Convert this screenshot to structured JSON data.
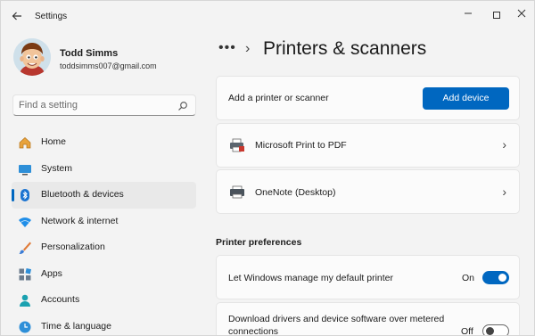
{
  "window": {
    "title": "Settings"
  },
  "profile": {
    "name": "Todd Simms",
    "email": "toddsimms007@gmail.com"
  },
  "search": {
    "placeholder": "Find a setting"
  },
  "nav": {
    "items": [
      {
        "label": "Home",
        "icon": "home-icon"
      },
      {
        "label": "System",
        "icon": "system-icon"
      },
      {
        "label": "Bluetooth & devices",
        "icon": "bluetooth-icon",
        "selected": true
      },
      {
        "label": "Network & internet",
        "icon": "wifi-icon"
      },
      {
        "label": "Personalization",
        "icon": "brush-icon"
      },
      {
        "label": "Apps",
        "icon": "apps-icon"
      },
      {
        "label": "Accounts",
        "icon": "accounts-icon"
      },
      {
        "label": "Time & language",
        "icon": "clock-icon"
      }
    ]
  },
  "header": {
    "breadcrumb_overflow": "•••",
    "separator": "›",
    "title": "Printers & scanners"
  },
  "add_card": {
    "label": "Add a printer or scanner",
    "button": "Add device"
  },
  "printers": [
    {
      "name": "Microsoft Print to PDF"
    },
    {
      "name": "OneNote (Desktop)"
    }
  ],
  "preferences": {
    "heading": "Printer preferences",
    "items": [
      {
        "label": "Let Windows manage my default printer",
        "state": "On",
        "on": true
      },
      {
        "label_line1": "Download drivers and device software over metered",
        "label_line2": "connections",
        "state": "Off",
        "on": false
      }
    ]
  },
  "colors": {
    "accent": "#0067c0",
    "background": "#f3f3f3",
    "card": "#fbfbfb"
  }
}
